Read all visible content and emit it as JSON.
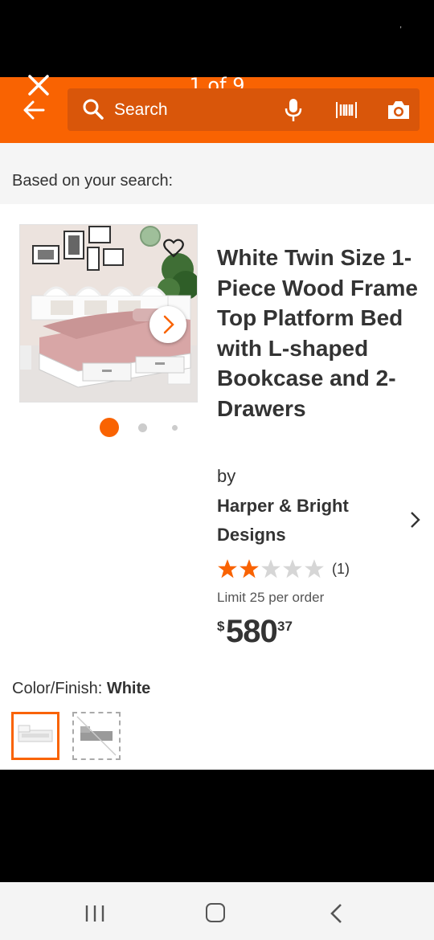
{
  "header": {
    "pager": "1 of 9",
    "search_placeholder": "Search",
    "brand_color": "#f96302"
  },
  "icons": [
    "close-icon",
    "back-arrow-icon",
    "search-icon",
    "microphone-icon",
    "barcode-icon",
    "camera-icon",
    "heart-icon",
    "chevron-right-icon"
  ],
  "search_context": "Based on your search:",
  "product": {
    "title": "White Twin Size 1-Piece Wood Frame Top Platform Bed with L-shaped Bookcase and 2-Drawers",
    "by_label": "by",
    "brand": "Harper & Bright Designs",
    "rating": {
      "stars": 2,
      "max": 5,
      "count": "(1)"
    },
    "limit": "Limit 25 per order",
    "price": {
      "currency": "$",
      "dollars": "580",
      "cents": "37"
    },
    "image_carousel": {
      "active_index": 0,
      "dots": 3
    },
    "color_label": "Color/Finish:",
    "color_value": "White",
    "swatches": [
      {
        "name": "White",
        "selected": true
      },
      {
        "name": "Gray",
        "selected": false
      }
    ]
  },
  "system_nav": [
    "recent-apps",
    "home",
    "back"
  ]
}
